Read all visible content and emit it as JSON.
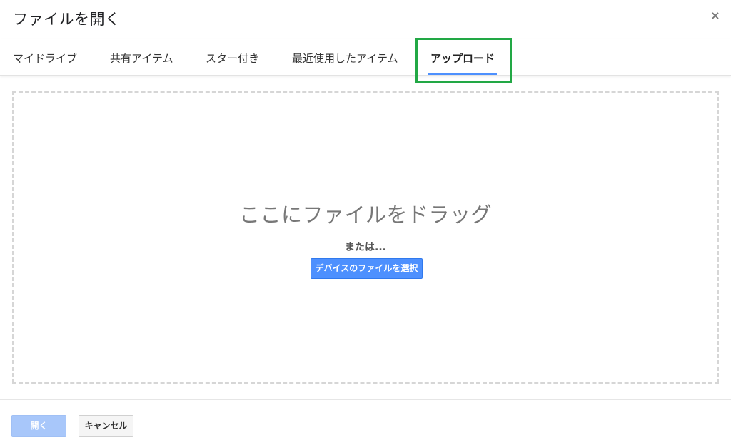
{
  "dialog": {
    "title": "ファイルを開く",
    "close_icon": "close-icon",
    "close_glyph": "×"
  },
  "tabs": [
    {
      "label": "マイドライブ",
      "active": false
    },
    {
      "label": "共有アイテム",
      "active": false
    },
    {
      "label": "スター付き",
      "active": false
    },
    {
      "label": "最近使用したアイテム",
      "active": false
    },
    {
      "label": "アップロード",
      "active": true
    }
  ],
  "upload": {
    "drag_text": "ここにファイルをドラッグ",
    "or_text": "または...",
    "select_button": "デバイスのファイルを選択"
  },
  "footer": {
    "open_button": "開く",
    "cancel_button": "キャンセル"
  },
  "colors": {
    "accent": "#4d90fe",
    "highlight": "#22a845",
    "open_disabled": "#a8c7fa"
  }
}
